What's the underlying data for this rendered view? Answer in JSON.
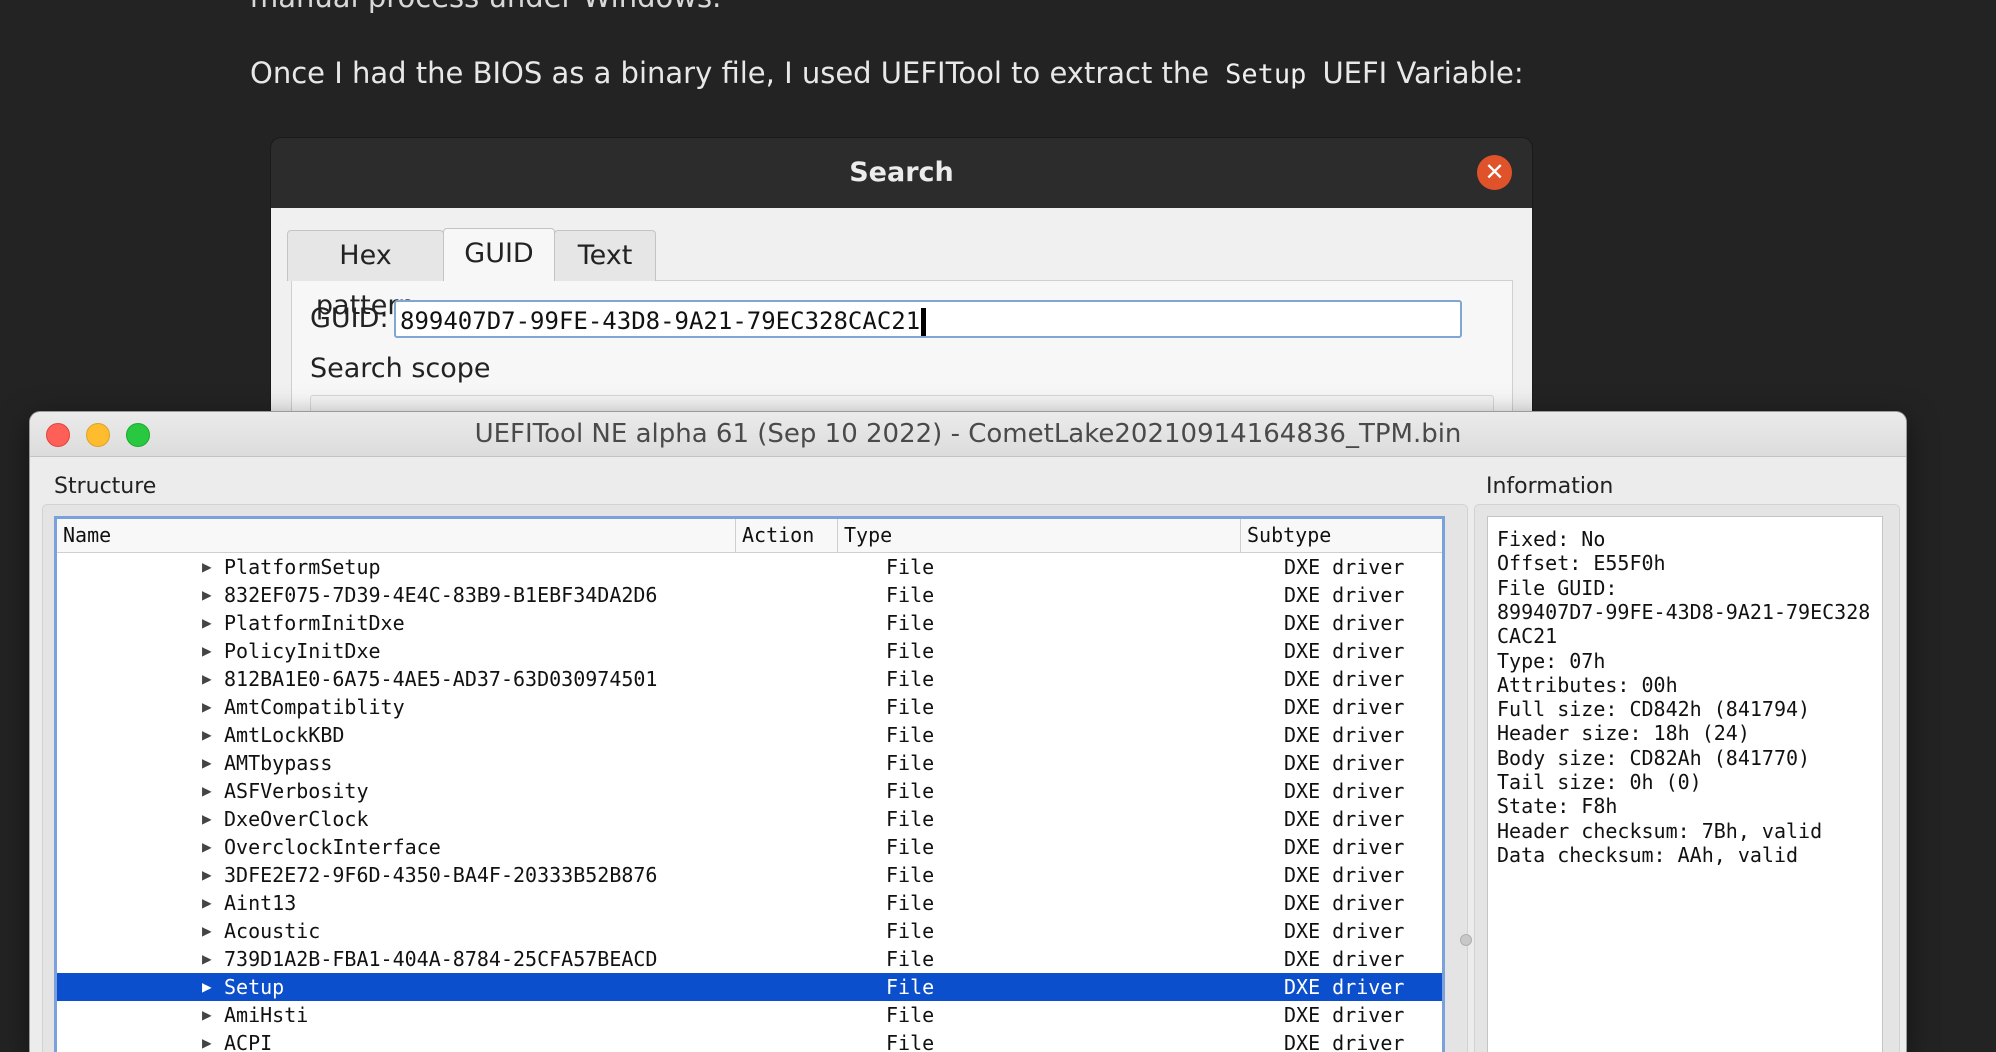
{
  "article": {
    "prev_line": "manual process under Windows.",
    "line_before": "Once I had the BIOS as a binary file, I used UEFITool to extract the",
    "code": "Setup",
    "line_after": "UEFI Variable:"
  },
  "search_dialog": {
    "title": "Search",
    "close_symbol": "✕",
    "tabs": [
      "Hex pattern",
      "GUID",
      "Text"
    ],
    "active_tab": "GUID",
    "guid_label": "GUID:",
    "guid_value": "899407D7-99FE-43D8-9A21-79EC328CAC21",
    "scope_label": "Search scope"
  },
  "main_window": {
    "title": "UEFITool NE alpha 61 (Sep 10 2022) - CometLake20210914164836_TPM.bin",
    "structure_label": "Structure",
    "information_label": "Information",
    "columns": [
      "Name",
      "Action",
      "Type",
      "Subtype"
    ],
    "rows": [
      {
        "name": "PlatformSetup",
        "type": "File",
        "subtype": "DXE driver"
      },
      {
        "name": "832EF075-7D39-4E4C-83B9-B1EBF34DA2D6",
        "type": "File",
        "subtype": "DXE driver"
      },
      {
        "name": "PlatformInitDxe",
        "type": "File",
        "subtype": "DXE driver"
      },
      {
        "name": "PolicyInitDxe",
        "type": "File",
        "subtype": "DXE driver"
      },
      {
        "name": "812BA1E0-6A75-4AE5-AD37-63D030974501",
        "type": "File",
        "subtype": "DXE driver"
      },
      {
        "name": "AmtCompatiblity",
        "type": "File",
        "subtype": "DXE driver"
      },
      {
        "name": "AmtLockKBD",
        "type": "File",
        "subtype": "DXE driver"
      },
      {
        "name": "AMTbypass",
        "type": "File",
        "subtype": "DXE driver"
      },
      {
        "name": "ASFVerbosity",
        "type": "File",
        "subtype": "DXE driver"
      },
      {
        "name": "DxeOverClock",
        "type": "File",
        "subtype": "DXE driver"
      },
      {
        "name": "OverclockInterface",
        "type": "File",
        "subtype": "DXE driver"
      },
      {
        "name": "3DFE2E72-9F6D-4350-BA4F-20333B52B876",
        "type": "File",
        "subtype": "DXE driver"
      },
      {
        "name": "Aint13",
        "type": "File",
        "subtype": "DXE driver"
      },
      {
        "name": "Acoustic",
        "type": "File",
        "subtype": "DXE driver"
      },
      {
        "name": "739D1A2B-FBA1-404A-8784-25CFA57BEACD",
        "type": "File",
        "subtype": "DXE driver"
      },
      {
        "name": "Setup",
        "type": "File",
        "subtype": "DXE driver",
        "selected": true
      },
      {
        "name": "AmiHsti",
        "type": "File",
        "subtype": "DXE driver"
      },
      {
        "name": "ACPI",
        "type": "File",
        "subtype": "DXE driver"
      }
    ],
    "info_lines": [
      "Fixed: No",
      "Offset: E55F0h",
      "File GUID:",
      "899407D7-99FE-43D8-9A21-79EC328",
      "CAC21",
      "Type: 07h",
      "Attributes: 00h",
      "Full size: CD842h (841794)",
      "Header size: 18h (24)",
      "Body size: CD82Ah (841770)",
      "Tail size: 0h (0)",
      "State: F8h",
      "Header checksum: 7Bh, valid",
      "Data checksum: AAh, valid"
    ],
    "selected_color": "#0b4fcc"
  }
}
